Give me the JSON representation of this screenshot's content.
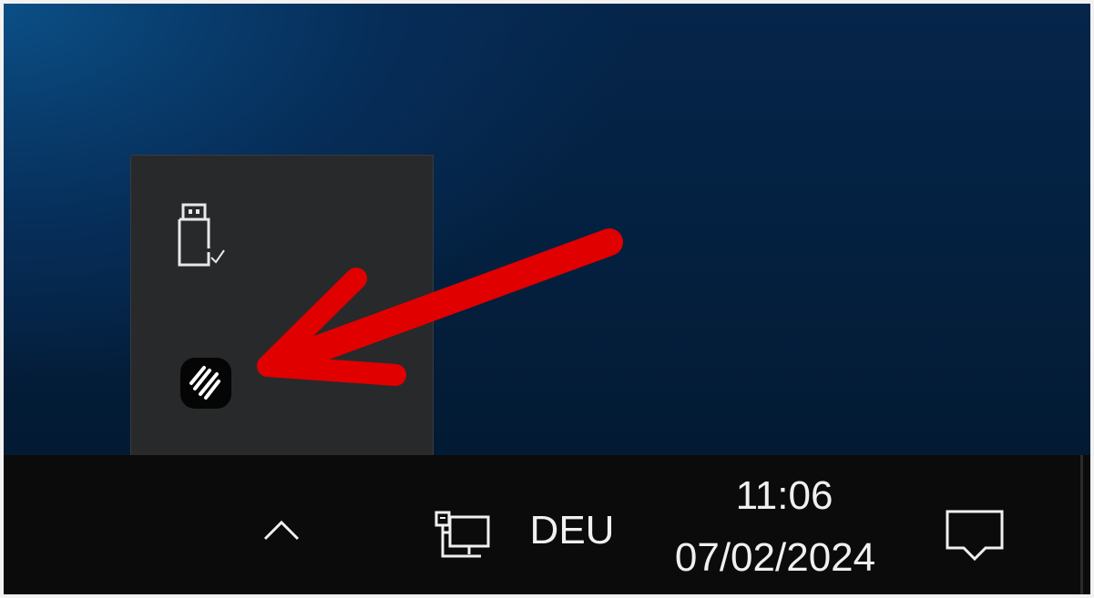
{
  "tray_overflow": {
    "items": [
      {
        "icon": "usb-safely-remove-icon"
      },
      {
        "icon": "app-tray-icon"
      }
    ]
  },
  "taskbar": {
    "chevron_icon": "chevron-up-icon",
    "network_icon": "wired-network-icon",
    "language": "DEU",
    "clock": {
      "time": "11:06",
      "date": "07/02/2024"
    },
    "notification_icon": "action-center-icon"
  },
  "annotation": {
    "arrow_color": "#e00000"
  }
}
